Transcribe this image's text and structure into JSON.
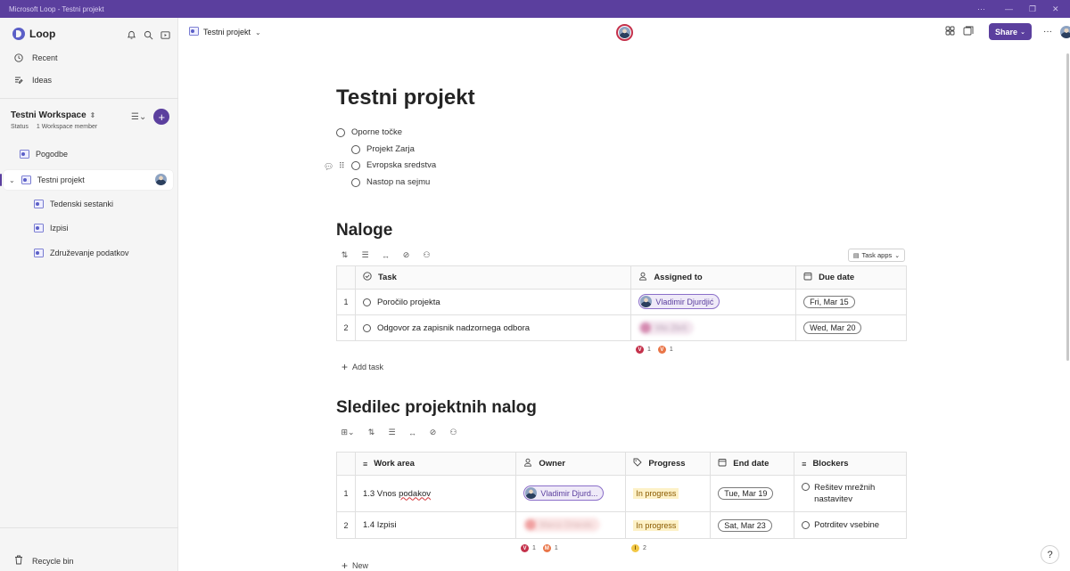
{
  "window": {
    "title": "Microsoft Loop - Testni projekt"
  },
  "sidebar": {
    "app_name": "Loop",
    "nav": [
      {
        "label": "Recent",
        "icon": "clock-icon"
      },
      {
        "label": "Ideas",
        "icon": "ideas-icon"
      }
    ],
    "workspace": {
      "name": "Testni Workspace",
      "status": "Status",
      "members": "1 Workspace member"
    },
    "pages": [
      {
        "label": "Pogodbe"
      },
      {
        "label": "Testni projekt"
      },
      {
        "label": "Tedenski sestanki"
      },
      {
        "label": "Izpisi"
      },
      {
        "label": "Združevanje podatkov"
      }
    ],
    "recycle": "Recycle bin"
  },
  "topbar": {
    "breadcrumb": "Testni projekt",
    "share_label": "Share"
  },
  "page": {
    "title": "Testni projekt",
    "outline": [
      {
        "label": "Oporne točke"
      },
      {
        "label": "Projekt Zarja"
      },
      {
        "label": "Evropska sredstva"
      },
      {
        "label": "Nastop na sejmu"
      }
    ]
  },
  "tasks": {
    "heading": "Naloge",
    "task_apps": "Task apps",
    "columns": [
      "Task",
      "Assigned to",
      "Due date"
    ],
    "rows": [
      {
        "num": "1",
        "task": "Poročilo projekta",
        "assigned": "Vladimir Djurdjić",
        "due": "Fri, Mar 15"
      },
      {
        "num": "2",
        "task": "Odgovor za zapisnik nadzornega odbora",
        "assigned": "Vito Zbrš",
        "due": "Wed, Mar 20"
      }
    ],
    "summary": [
      {
        "letter": "V",
        "count": "1",
        "color": "#c4314b"
      },
      {
        "letter": "V",
        "count": "1",
        "color": "#e97548"
      }
    ],
    "add_label": "Add task"
  },
  "tracker": {
    "heading": "Sledilec projektnih nalog",
    "columns": [
      "Work area",
      "Owner",
      "Progress",
      "End date",
      "Blockers"
    ],
    "rows": [
      {
        "num": "1",
        "area": "1.3 Vnos ",
        "area_underlined": "podakov",
        "owner": "Vladimir Djurd...",
        "progress": "In progress",
        "end": "Tue, Mar 19",
        "blocker": "Rešitev mrežnih nastavitev"
      },
      {
        "num": "2",
        "area": "1.4 Izpisi",
        "area_underlined": "",
        "owner": "Marco Orlando",
        "progress": "In progress",
        "end": "Sat, Mar 23",
        "blocker": "Potrditev vsebine"
      }
    ],
    "owner_summary": [
      {
        "letter": "V",
        "count": "1",
        "color": "#c4314b"
      },
      {
        "letter": "M",
        "count": "1",
        "color": "#e97548"
      }
    ],
    "progress_summary": [
      {
        "letter": "I",
        "count": "2",
        "color": "#f2c744"
      }
    ],
    "add_label": "New"
  },
  "help": "?"
}
